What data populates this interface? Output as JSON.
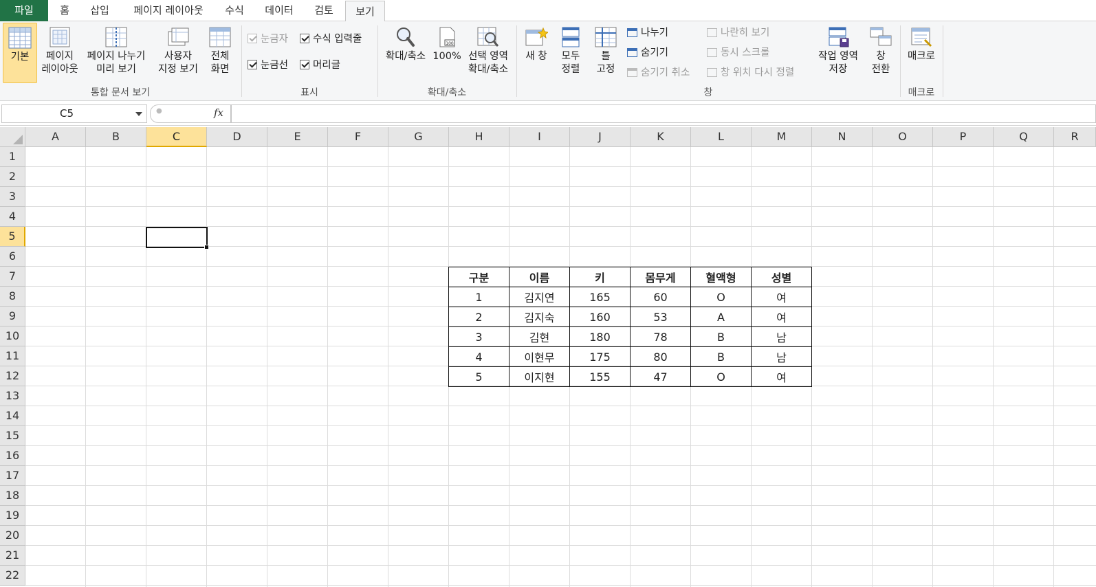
{
  "tabs": [
    {
      "label": "파일"
    },
    {
      "label": "홈"
    },
    {
      "label": "삽입"
    },
    {
      "label": "페이지 레이아웃"
    },
    {
      "label": "수식"
    },
    {
      "label": "데이터"
    },
    {
      "label": "검토"
    },
    {
      "label": "보기"
    }
  ],
  "ribbon": {
    "workbook_views": {
      "group_label": "통합 문서 보기",
      "normal": {
        "line1": "기본"
      },
      "page_layout": {
        "line1": "페이지",
        "line2": "레이아웃"
      },
      "page_break": {
        "line1": "페이지 나누기",
        "line2": "미리 보기"
      },
      "custom": {
        "line1": "사용자",
        "line2": "지정 보기"
      },
      "full": {
        "line1": "전체",
        "line2": "화면"
      }
    },
    "show": {
      "group_label": "표시",
      "ruler": "눈금자",
      "formula_bar": "수식 입력줄",
      "gridlines": "눈금선",
      "headings": "머리글"
    },
    "zoom": {
      "group_label": "확대/축소",
      "zoom": {
        "line1": "확대/축소"
      },
      "hundred": {
        "line1": "100%"
      },
      "zoom_selection": {
        "line1": "선택 영역",
        "line2": "확대/축소"
      }
    },
    "window": {
      "group_label": "창",
      "new_window": {
        "line1": "새 창"
      },
      "arrange_all": {
        "line1": "모두",
        "line2": "정렬"
      },
      "freeze": {
        "line1": "틀",
        "line2": "고정"
      },
      "split": "나누기",
      "hide": "숨기기",
      "unhide": "숨기기 취소",
      "side_by_side": "나란히 보기",
      "sync_scroll": "동시 스크롤",
      "reset_position": "창 위치 다시 정렬",
      "save_workspace": {
        "line1": "작업 영역",
        "line2": "저장"
      },
      "switch_windows": {
        "line1": "창",
        "line2": "전환"
      }
    },
    "macros": {
      "group_label": "매크로",
      "macros": {
        "line1": "매크로"
      }
    }
  },
  "formula_bar": {
    "name_box": "C5",
    "fx": "fx",
    "formula": ""
  },
  "grid": {
    "columns": [
      "A",
      "B",
      "C",
      "D",
      "E",
      "F",
      "G",
      "H",
      "I",
      "J",
      "K",
      "L",
      "M",
      "N",
      "O",
      "P",
      "Q",
      "R"
    ],
    "rows": [
      "1",
      "2",
      "3",
      "4",
      "5",
      "6",
      "7",
      "8",
      "9",
      "10",
      "11",
      "12",
      "13",
      "14",
      "15",
      "16",
      "17",
      "18",
      "19",
      "20",
      "21",
      "22"
    ],
    "selected_column": "C",
    "selected_row": "5"
  },
  "table": {
    "headers": [
      "구분",
      "이름",
      "키",
      "몸무게",
      "혈액형",
      "성별"
    ],
    "rows": [
      [
        "1",
        "김지연",
        "165",
        "60",
        "O",
        "여"
      ],
      [
        "2",
        "김지숙",
        "160",
        "53",
        "A",
        "여"
      ],
      [
        "3",
        "김현",
        "180",
        "78",
        "B",
        "남"
      ],
      [
        "4",
        "이현무",
        "175",
        "80",
        "B",
        "남"
      ],
      [
        "5",
        "이지현",
        "155",
        "47",
        "O",
        "여"
      ]
    ]
  },
  "colors": {
    "accent_green": "#217346",
    "selection_yellow": "#fde29a"
  }
}
